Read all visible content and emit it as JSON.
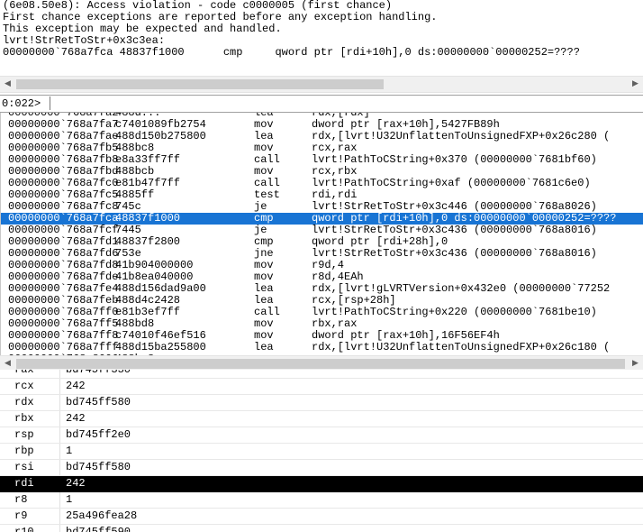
{
  "command_output": {
    "lines": [
      "(6e08.50e8): Access violation - code c0000005 (first chance)",
      "First chance exceptions are reported before any exception handling.",
      "This exception may be expected and handled.",
      "lvrt!StrRetToStr+0x3c3ea:",
      "00000000`768a7fca 48837f1000      cmp     qword ptr [rdi+10h],0 ds:00000000`00000252=????"
    ]
  },
  "scroll_icons": {
    "left": "left-arrow-icon",
    "right": "right-arrow-icon"
  },
  "command_line": {
    "prompt": "0:022>",
    "value": "",
    "placeholder": ""
  },
  "disassembly": {
    "rows": [
      {
        "addr": "00000000`768a7fa2",
        "bytes": "488d...",
        "mnem": "lea",
        "ops": "rdx,[rdx]",
        "partial": true
      },
      {
        "addr": "00000000`768a7fa7",
        "bytes": "c7401089fb2754",
        "mnem": "mov",
        "ops": "dword ptr [rax+10h],5427FB89h"
      },
      {
        "addr": "00000000`768a7fae",
        "bytes": "488d150b275800",
        "mnem": "lea",
        "ops": "rdx,[lvrt!U32UnflattenToUnsignedFXP+0x26c280 ("
      },
      {
        "addr": "00000000`768a7fb5",
        "bytes": "488bc8",
        "mnem": "mov",
        "ops": "rcx,rax"
      },
      {
        "addr": "00000000`768a7fb8",
        "bytes": "e8a33ff7ff",
        "mnem": "call",
        "ops": "lvrt!PathToCString+0x370 (00000000`7681bf60)"
      },
      {
        "addr": "00000000`768a7fbd",
        "bytes": "488bcb",
        "mnem": "mov",
        "ops": "rcx,rbx"
      },
      {
        "addr": "00000000`768a7fc0",
        "bytes": "e81b47f7ff",
        "mnem": "call",
        "ops": "lvrt!PathToCString+0xaf (00000000`7681c6e0)"
      },
      {
        "addr": "00000000`768a7fc5",
        "bytes": "4885ff",
        "mnem": "test",
        "ops": "rdi,rdi"
      },
      {
        "addr": "00000000`768a7fc8",
        "bytes": "745c",
        "mnem": "je",
        "ops": "lvrt!StrRetToStr+0x3c446 (00000000`768a8026)"
      },
      {
        "addr": "00000000`768a7fca",
        "bytes": "48837f1000",
        "mnem": "cmp",
        "ops": "qword ptr [rdi+10h],0 ds:00000000`00000252=????",
        "selected": true
      },
      {
        "addr": "00000000`768a7fcf",
        "bytes": "7445",
        "mnem": "je",
        "ops": "lvrt!StrRetToStr+0x3c436 (00000000`768a8016)"
      },
      {
        "addr": "00000000`768a7fd1",
        "bytes": "48837f2800",
        "mnem": "cmp",
        "ops": "qword ptr [rdi+28h],0"
      },
      {
        "addr": "00000000`768a7fd6",
        "bytes": "753e",
        "mnem": "jne",
        "ops": "lvrt!StrRetToStr+0x3c436 (00000000`768a8016)"
      },
      {
        "addr": "00000000`768a7fd8",
        "bytes": "41b904000000",
        "mnem": "mov",
        "ops": "r9d,4"
      },
      {
        "addr": "00000000`768a7fde",
        "bytes": "41b8ea040000",
        "mnem": "mov",
        "ops": "r8d,4EAh"
      },
      {
        "addr": "00000000`768a7fe4",
        "bytes": "488d156dad9a00",
        "mnem": "lea",
        "ops": "rdx,[lvrt!gLVRTVersion+0x432e0 (00000000`77252"
      },
      {
        "addr": "00000000`768a7feb",
        "bytes": "488d4c2428",
        "mnem": "lea",
        "ops": "rcx,[rsp+28h]"
      },
      {
        "addr": "00000000`768a7ff0",
        "bytes": "e81b3ef7ff",
        "mnem": "call",
        "ops": "lvrt!PathToCString+0x220 (00000000`7681be10)"
      },
      {
        "addr": "00000000`768a7ff5",
        "bytes": "488bd8",
        "mnem": "mov",
        "ops": "rbx,rax"
      },
      {
        "addr": "00000000`768a7ff8",
        "bytes": "c74010f46ef516",
        "mnem": "mov",
        "ops": "dword ptr [rax+10h],16F56EF4h"
      },
      {
        "addr": "00000000`768a7fff",
        "bytes": "488d15ba255800",
        "mnem": "lea",
        "ops": "rdx,[lvrt!U32UnflattenToUnsignedFXP+0x26c180 ("
      },
      {
        "addr": "00000000`768a8006",
        "bytes": "488bc8",
        "mnem": "mov",
        "ops": "rcx,rax",
        "partial_bottom": true
      }
    ]
  },
  "registers": {
    "rows": [
      {
        "name": "rax",
        "value": "bd745ff330",
        "partial": true
      },
      {
        "name": "rcx",
        "value": "242"
      },
      {
        "name": "rdx",
        "value": "bd745ff580"
      },
      {
        "name": "rbx",
        "value": "242"
      },
      {
        "name": "rsp",
        "value": "bd745ff2e0"
      },
      {
        "name": "rbp",
        "value": "1"
      },
      {
        "name": "rsi",
        "value": "bd745ff580"
      },
      {
        "name": "rdi",
        "value": "242",
        "selected": true
      },
      {
        "name": "r8",
        "value": "1"
      },
      {
        "name": "r9",
        "value": "25a496fea28"
      },
      {
        "name": "r10",
        "value": "bd745ff590"
      }
    ]
  }
}
